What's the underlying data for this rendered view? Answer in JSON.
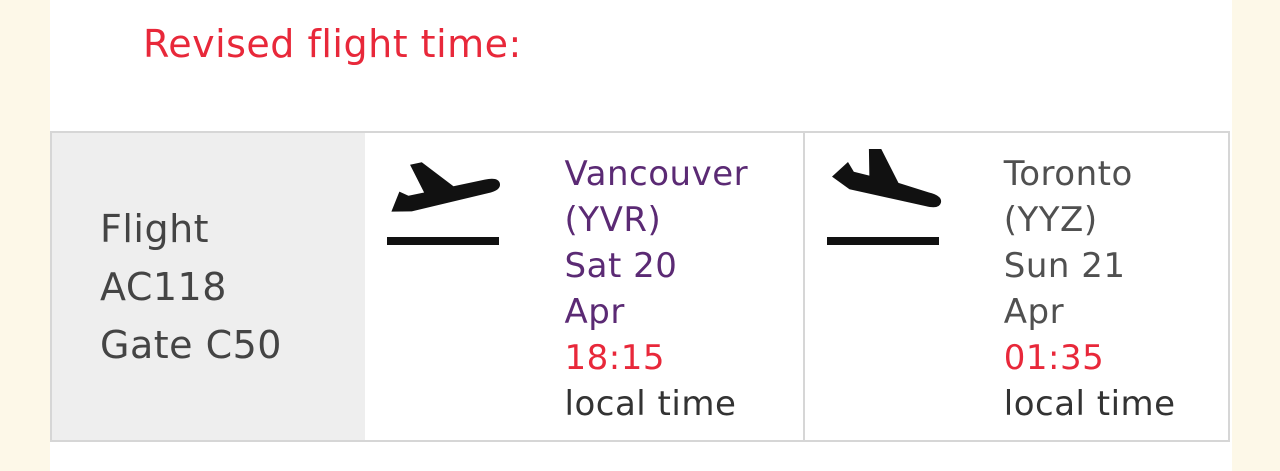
{
  "heading": "Revised flight time:",
  "flight_info": {
    "line1": "Flight",
    "line2": "AC118",
    "line3": "Gate C50"
  },
  "departure": {
    "icon": "plane-takeoff-icon",
    "city": "Vancouver",
    "code": "(YVR)",
    "date_day": "Sat 20",
    "date_month": "Apr",
    "time": "18:15",
    "time_note": "local time"
  },
  "arrival": {
    "icon": "plane-landing-icon",
    "city": "Toronto",
    "code": "(YYZ)",
    "date_day": "Sun 21",
    "date_month": "Apr",
    "time": "01:35",
    "time_note": "local time"
  },
  "colors": {
    "heading": "#e8283a",
    "departure_text": "#5b2a74",
    "arrival_text": "#505050",
    "time": "#e8283a",
    "info_background": "#eeeeee",
    "page_background": "#fdf8e8"
  }
}
